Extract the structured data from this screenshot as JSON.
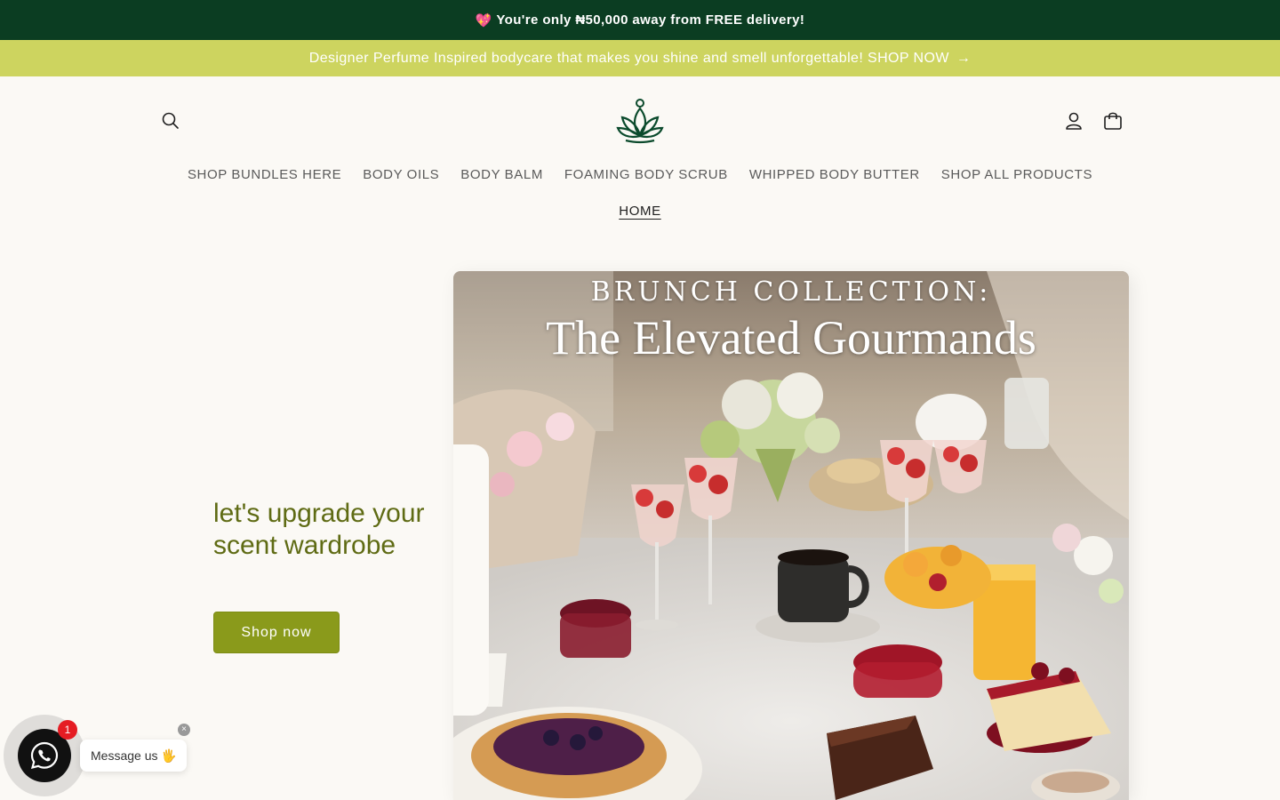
{
  "announcement": {
    "emoji": "💖",
    "text": "You're only ₦50,000 away from FREE delivery!"
  },
  "promo": {
    "text": "Designer Perfume Inspired bodycare that makes you shine and smell unforgettable! SHOP NOW",
    "arrow": "→"
  },
  "header": {
    "icons": [
      "search-icon",
      "lotus-logo",
      "account-icon",
      "cart-icon"
    ]
  },
  "nav": {
    "items": [
      {
        "label": "SHOP BUNDLES HERE"
      },
      {
        "label": "BODY OILS"
      },
      {
        "label": "BODY BALM"
      },
      {
        "label": "FOAMING BODY SCRUB"
      },
      {
        "label": "WHIPPED BODY BUTTER"
      },
      {
        "label": "SHOP ALL PRODUCTS"
      }
    ],
    "home": "HOME"
  },
  "hero": {
    "title": "let's upgrade your scent wardrobe",
    "button_label": "Shop now",
    "image_title_line1": "BRUNCH COLLECTION:",
    "image_title_line2": "The Elevated Gourmands"
  },
  "whatsapp": {
    "badge_count": "1",
    "message": "Message us 🖐",
    "close": "×"
  },
  "colors": {
    "announcement_bg": "#0b3d22",
    "promo_bg": "#cdd45f",
    "accent": "#8a9a1b",
    "hero_title": "#5f6b14"
  }
}
